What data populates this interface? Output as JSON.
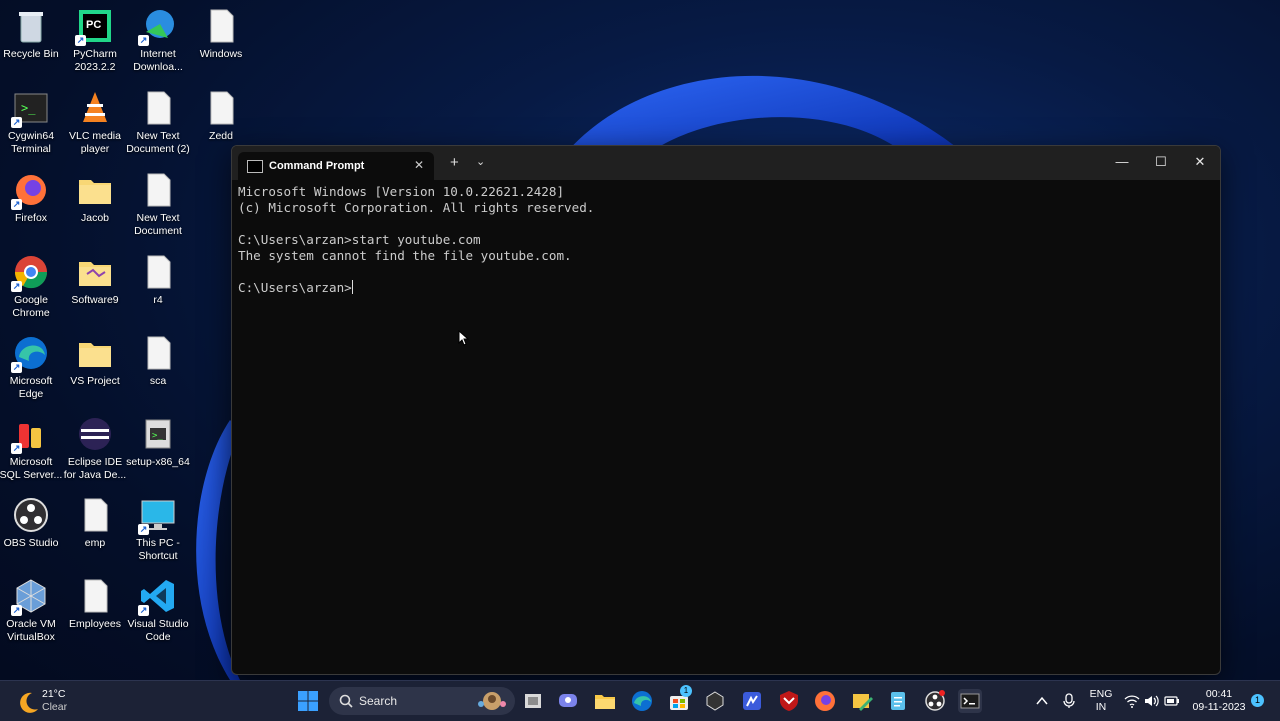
{
  "desktop": {
    "icons": [
      {
        "label": "Recycle Bin"
      },
      {
        "label": "PyCharm\n2023.2.2"
      },
      {
        "label": "Internet\nDownloa..."
      },
      {
        "label": "Windows"
      },
      {
        "label": "Cygwin64\nTerminal"
      },
      {
        "label": "VLC media\nplayer"
      },
      {
        "label": "New Text\nDocument (2)"
      },
      {
        "label": "Zedd"
      },
      {
        "label": "Firefox"
      },
      {
        "label": "Jacob"
      },
      {
        "label": "New Text\nDocument"
      },
      {
        "label": "Google\nChrome"
      },
      {
        "label": "Software9"
      },
      {
        "label": "r4"
      },
      {
        "label": "Microsoft\nEdge"
      },
      {
        "label": "VS Project"
      },
      {
        "label": "sca"
      },
      {
        "label": "Microsoft\nSQL Server..."
      },
      {
        "label": "Eclipse IDE\nfor Java De..."
      },
      {
        "label": "setup-x86_64"
      },
      {
        "label": "OBS Studio"
      },
      {
        "label": "emp"
      },
      {
        "label": "This PC -\nShortcut"
      },
      {
        "label": "Oracle VM\nVirtualBox"
      },
      {
        "label": "Employees"
      },
      {
        "label": "Visual Studio\nCode"
      }
    ]
  },
  "terminal": {
    "tab_title": "Command Prompt",
    "tab_close": "✕",
    "new_tab": "+",
    "dropdown": "⌄",
    "minimize": "—",
    "maximize": "☐",
    "close": "✕",
    "lines": [
      "Microsoft Windows [Version 10.0.22621.2428]",
      "(c) Microsoft Corporation. All rights reserved.",
      "",
      "C:\\Users\\arzan>start youtube.com",
      "The system cannot find the file youtube.com.",
      "",
      "C:\\Users\\arzan>"
    ]
  },
  "taskbar": {
    "weather_temp": "21°C",
    "weather_desc": "Clear",
    "search_label": "Search",
    "store_badge": "1",
    "language_line1": "ENG",
    "language_line2": "IN",
    "time": "00:41",
    "date": "09-11-2023",
    "notification_count": "1"
  },
  "colors": {
    "console_bg": "#0c0c0c",
    "console_text": "#cccccc",
    "titlebar": "#202020",
    "taskbar": "#1c2236",
    "accent": "#1a5fd0"
  }
}
